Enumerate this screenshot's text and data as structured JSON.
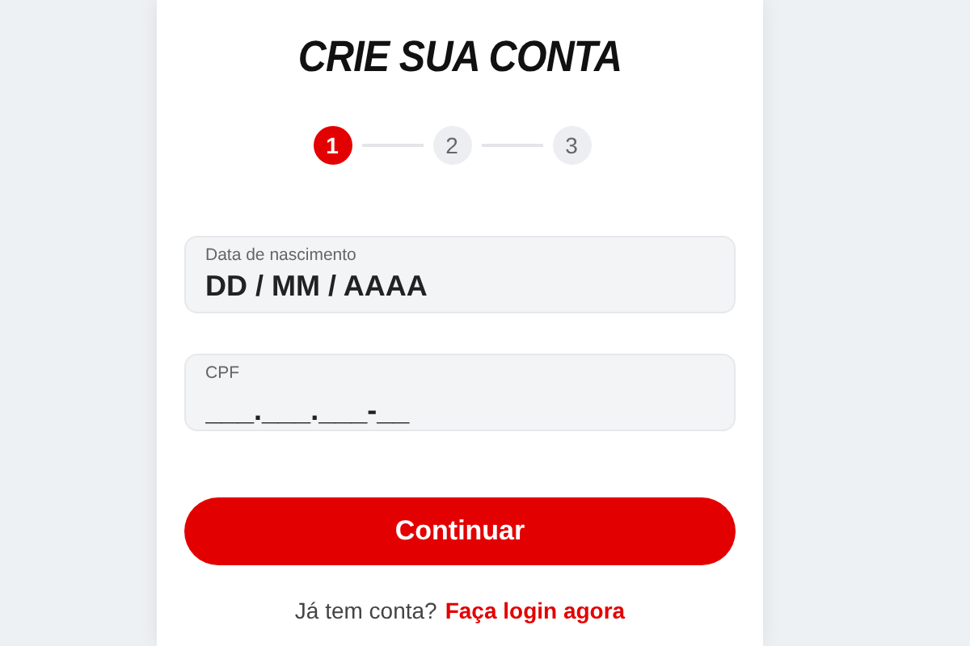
{
  "title": "CRIE SUA CONTA",
  "steps": [
    {
      "label": "1",
      "selected": true
    },
    {
      "label": "2",
      "selected": false
    },
    {
      "label": "3",
      "selected": false
    }
  ],
  "fields": [
    {
      "label": "Data de nascimento",
      "placeholder": "DD / MM / AAAA"
    },
    {
      "label": "CPF",
      "placeholder": "___.___.___-__"
    }
  ],
  "button": "Continuar",
  "footer": {
    "text": "Já tem conta?",
    "link": "Faça login agora"
  }
}
